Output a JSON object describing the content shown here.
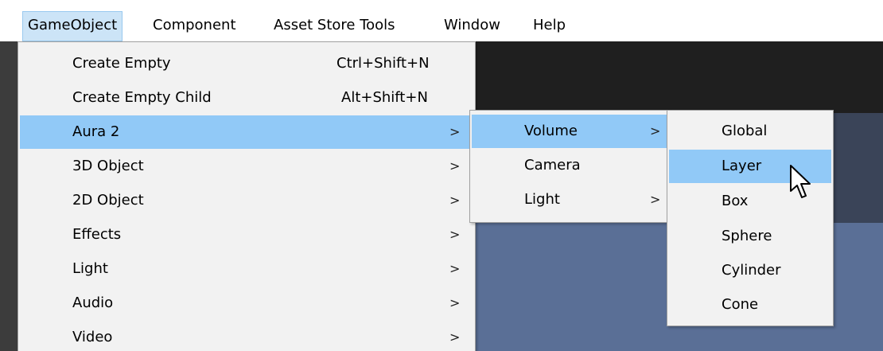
{
  "menubar": {
    "items": [
      {
        "label": "GameObject",
        "active": true
      },
      {
        "label": "Component",
        "active": false
      },
      {
        "label": "Asset Store Tools",
        "active": false
      },
      {
        "label": "Window",
        "active": false
      },
      {
        "label": "Help",
        "active": false
      }
    ]
  },
  "gameobject_menu": {
    "items": [
      {
        "label": "Create Empty",
        "shortcut": "Ctrl+Shift+N",
        "submenu": false
      },
      {
        "label": "Create Empty Child",
        "shortcut": "Alt+Shift+N",
        "submenu": false
      },
      {
        "label": "Aura 2",
        "shortcut": "",
        "submenu": true,
        "highlighted": true
      },
      {
        "label": "3D Object",
        "shortcut": "",
        "submenu": true
      },
      {
        "label": "2D Object",
        "shortcut": "",
        "submenu": true
      },
      {
        "label": "Effects",
        "shortcut": "",
        "submenu": true
      },
      {
        "label": "Light",
        "shortcut": "",
        "submenu": true
      },
      {
        "label": "Audio",
        "shortcut": "",
        "submenu": true
      },
      {
        "label": "Video",
        "shortcut": "",
        "submenu": true
      }
    ]
  },
  "aura_menu": {
    "items": [
      {
        "label": "Volume",
        "submenu": true,
        "highlighted": true
      },
      {
        "label": "Camera",
        "submenu": false
      },
      {
        "label": "Light",
        "submenu": true
      }
    ]
  },
  "volume_menu": {
    "items": [
      {
        "label": "Global",
        "highlighted": false
      },
      {
        "label": "Layer",
        "highlighted": true
      },
      {
        "label": "Box",
        "highlighted": false
      },
      {
        "label": "Sphere",
        "highlighted": false
      },
      {
        "label": "Cylinder",
        "highlighted": false
      },
      {
        "label": "Cone",
        "highlighted": false
      }
    ]
  },
  "submenu_arrow": ">",
  "colors": {
    "highlight": "#91c9f7",
    "menu_bg": "#f2f2f2",
    "menubar_active": "#cce4f7"
  }
}
